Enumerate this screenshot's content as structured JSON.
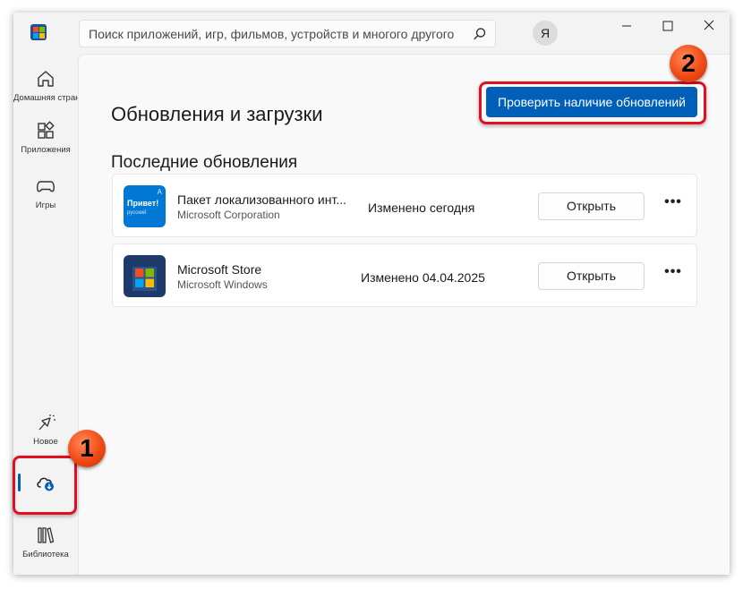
{
  "search": {
    "placeholder": "Поиск приложений, игр, фильмов, устройств и многого другого"
  },
  "avatar": {
    "initial": "Я"
  },
  "sidebar": {
    "items": [
      {
        "label": "Домашняя страница",
        "icon": "home-icon"
      },
      {
        "label": "Приложения",
        "icon": "apps-icon"
      },
      {
        "label": "Игры",
        "icon": "gamepad-icon"
      },
      {
        "label": "Новое",
        "icon": "sparkle-icon"
      },
      {
        "label": "",
        "icon": "cloud-download-icon"
      },
      {
        "label": "Библиотека",
        "icon": "library-icon"
      }
    ]
  },
  "main": {
    "title": "Обновления и загрузки",
    "check_button": "Проверить наличие обновлений",
    "section_title": "Последние обновления",
    "apps": [
      {
        "name": "Пакет локализованного инт...",
        "publisher": "Microsoft Corporation",
        "status": "Изменено сегодня",
        "open_label": "Открыть",
        "icon_text": "Привет!",
        "icon_subtext": "русский"
      },
      {
        "name": "Microsoft Store",
        "publisher": "Microsoft Windows",
        "status": "Изменено 04.04.2025",
        "open_label": "Открыть"
      }
    ]
  },
  "callouts": {
    "one": "1",
    "two": "2"
  },
  "colors": {
    "accent": "#005fb8",
    "callout": "#e01020"
  }
}
